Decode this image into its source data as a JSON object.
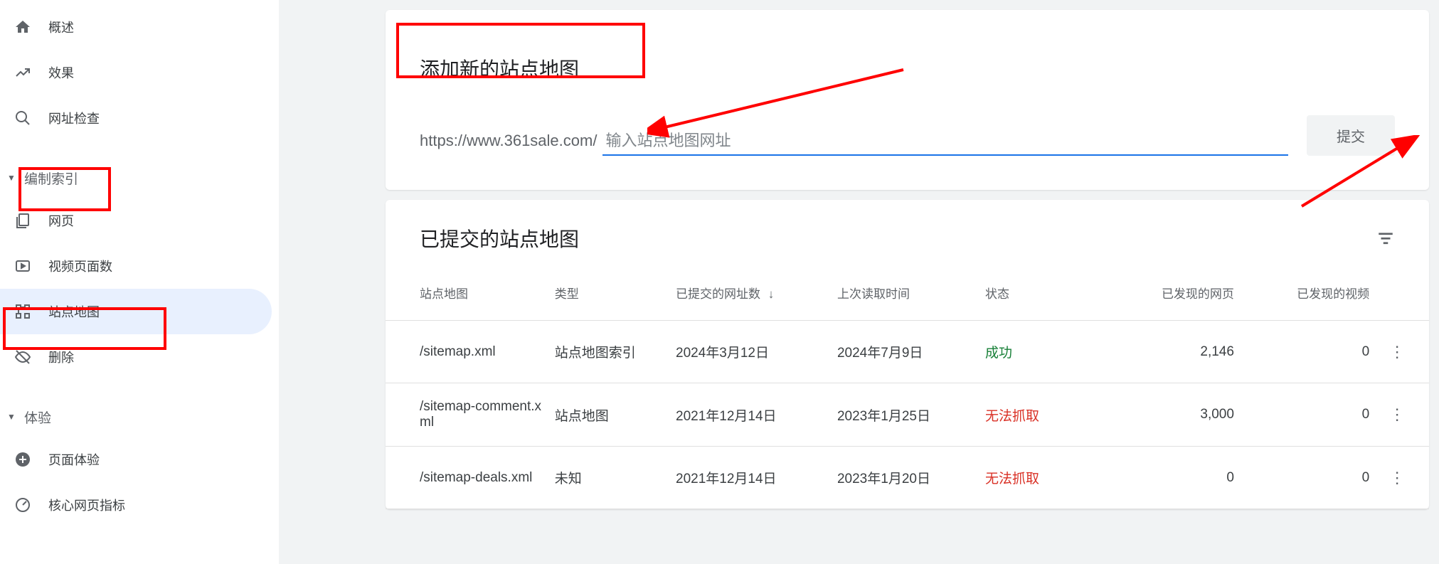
{
  "sidebar": {
    "overview": "概述",
    "performance": "效果",
    "url_inspect": "网址检查",
    "index_section": "编制索引",
    "pages": "网页",
    "video_pages": "视频页面数",
    "sitemaps": "站点地图",
    "removals": "删除",
    "experience_section": "体验",
    "page_experience": "页面体验",
    "core_web_vitals": "核心网页指标"
  },
  "add_card": {
    "title": "添加新的站点地图",
    "url_prefix": "https://www.361sale.com/",
    "placeholder": "输入站点地图网址",
    "submit": "提交"
  },
  "list_card": {
    "title": "已提交的站点地图",
    "headers": {
      "sitemap": "站点地图",
      "type": "类型",
      "submitted": "已提交的网址数",
      "last_read": "上次读取时间",
      "status": "状态",
      "pages_found": "已发现的网页",
      "videos_found": "已发现的视频"
    },
    "rows": [
      {
        "sitemap": "/sitemap.xml",
        "type": "站点地图索引",
        "submitted": "2024年3月12日",
        "last_read": "2024年7月9日",
        "status": "成功",
        "status_class": "status-success",
        "pages": "2,146",
        "videos": "0"
      },
      {
        "sitemap": "/sitemap-comment.xml",
        "type": "站点地图",
        "submitted": "2021年12月14日",
        "last_read": "2023年1月25日",
        "status": "无法抓取",
        "status_class": "status-fail",
        "pages": "3,000",
        "videos": "0"
      },
      {
        "sitemap": "/sitemap-deals.xml",
        "type": "未知",
        "submitted": "2021年12月14日",
        "last_read": "2023年1月20日",
        "status": "无法抓取",
        "status_class": "status-fail",
        "pages": "0",
        "videos": "0"
      }
    ]
  }
}
